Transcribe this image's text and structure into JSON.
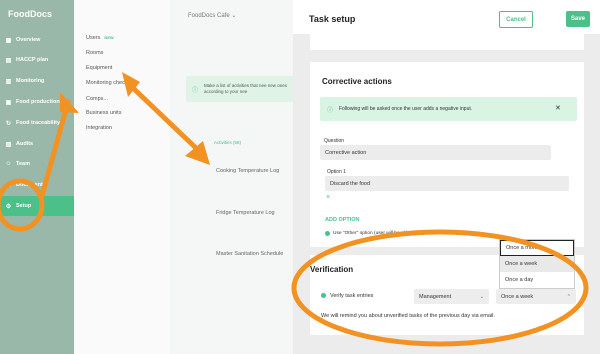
{
  "sidebar": {
    "logo": "FoodDocs",
    "items": [
      {
        "label": "Overview",
        "icon": "grid-icon"
      },
      {
        "label": "HACCP plan",
        "icon": "document-icon"
      },
      {
        "label": "Monitoring",
        "icon": "chart-icon"
      },
      {
        "label": "Food production",
        "icon": "cart-icon"
      },
      {
        "label": "Food traceability",
        "icon": "cycle-icon"
      },
      {
        "label": "Audits",
        "icon": "clipboard-icon"
      },
      {
        "label": "Team",
        "icon": "people-icon"
      },
      {
        "label": "Documents",
        "icon": "folder-icon"
      },
      {
        "label": "Setup",
        "icon": "gear-icon"
      }
    ]
  },
  "submenu": {
    "items": [
      "Users",
      "Rooms",
      "Equipment",
      "Monitoring checks",
      "Comps...",
      "Business units",
      "Integration"
    ],
    "users_badge": "NEW"
  },
  "middle": {
    "cafe_name": "FoodDocs Cafe",
    "info_text": "Make a list of activities that nee new ones according to your nee",
    "activities_tab": "Activities (58)",
    "tasks": [
      "Cooking Temperature Log",
      "Fridge Temperature Log",
      "Master Sanitation Schedule"
    ]
  },
  "panel": {
    "title": "Task setup",
    "cancel_label": "Cancel",
    "save_label": "Save",
    "corrective": {
      "title": "Corrective actions",
      "info": "Following will be asked once the user adds a negative input.",
      "question_label": "Question",
      "question_value": "Corrective action",
      "option_label": "Option 1",
      "option_value": "Discard the food",
      "add_option": "ADD OPTION",
      "other_option": "Use \"Other\" option (user will be able to type in custom answer)"
    },
    "verification": {
      "title": "Verification",
      "checkbox_label": "Verify task entries",
      "role_value": "Management",
      "frequency_value": "Once a week",
      "reminder": "We will remind you about unverified tasks of the previous day via email.",
      "frequency_options": [
        "Once a month",
        "Once a week",
        "Once a day"
      ]
    }
  },
  "colors": {
    "accent": "#4cc089",
    "annotation": "#f29222"
  }
}
